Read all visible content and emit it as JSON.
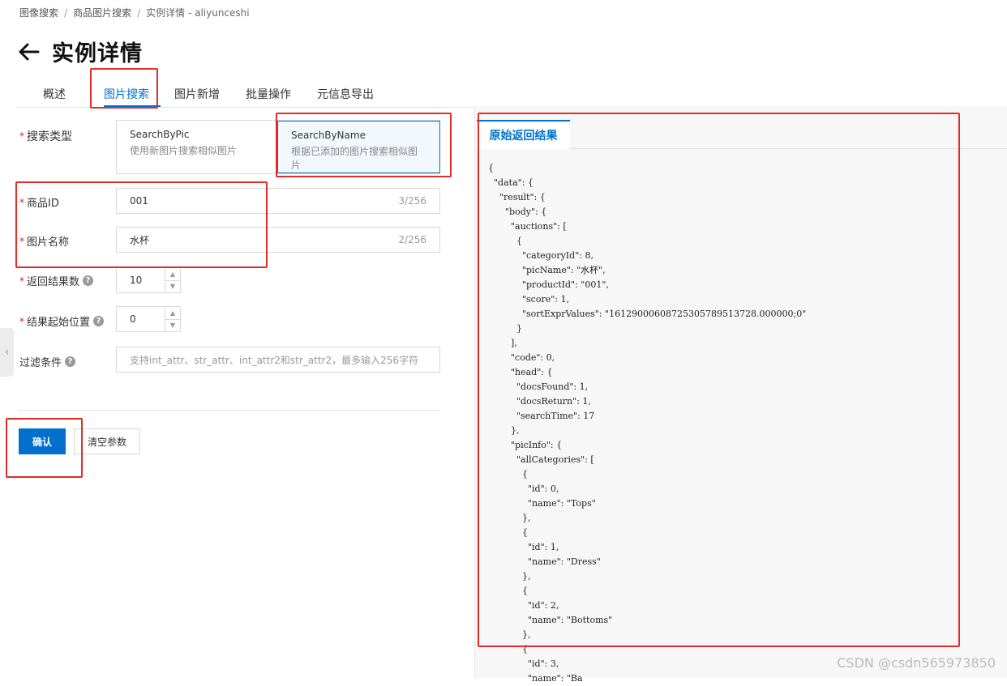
{
  "breadcrumb": {
    "items": [
      "图像搜索",
      "商品图片搜索",
      "实例详情 - aliyunceshi"
    ],
    "separator": "/"
  },
  "page_title": "实例详情",
  "back_icon": "arrow-left-icon",
  "tabs": [
    "概述",
    "图片搜索",
    "图片新增",
    "批量操作",
    "元信息导出"
  ],
  "active_tab": "图片搜索",
  "form": {
    "search_type": {
      "label": "搜索类型",
      "options": [
        {
          "title": "SearchByPic",
          "desc": "使用新图片搜索相似图片"
        },
        {
          "title": "SearchByName",
          "desc": "根据已添加的图片搜索相似图片"
        }
      ],
      "selected": "SearchByName"
    },
    "product_id": {
      "label": "商品ID",
      "value": "001",
      "count": "3/256"
    },
    "pic_name": {
      "label": "图片名称",
      "value": "水杯",
      "count": "2/256"
    },
    "num": {
      "label": "返回结果数",
      "value": "10"
    },
    "start": {
      "label": "结果起始位置",
      "value": "0"
    },
    "filter": {
      "label": "过滤条件",
      "placeholder": "支持int_attr、str_attr、int_attr2和str_attr2，最多输入256字符"
    },
    "required_mark": "*",
    "help_glyph": "?"
  },
  "buttons": {
    "confirm": "确认",
    "clear": "清空参数"
  },
  "result_panel": {
    "tab": "原始返回结果",
    "json_text": "{\n  \"data\": {\n    \"result\": {\n      \"body\": {\n        \"auctions\": [\n          {\n            \"categoryId\": 8,\n            \"picName\": \"水杯\",\n            \"productId\": \"001\",\n            \"score\": 1,\n            \"sortExprValues\": \"1612900060872530578951372​8.000000;0\"\n          }\n        ],\n        \"code\": 0,\n        \"head\": {\n          \"docsFound\": 1,\n          \"docsReturn\": 1,\n          \"searchTime\": 17\n        },\n        \"picInfo\": {\n          \"allCategories\": [\n            {\n              \"id\": 0,\n              \"name\": \"Tops\"\n            },\n            {\n              \"id\": 1,\n              \"name\": \"Dress\"\n            },\n            {\n              \"id\": 2,\n              \"name\": \"Bottoms\"\n            },\n            {\n              \"id\": 3,\n              \"name\": \"Ba"
  },
  "watermark": "CSDN @csdn565973850",
  "colors": {
    "accent": "#0070cc",
    "annotation": "#e52b26",
    "required": "#e0202a"
  }
}
